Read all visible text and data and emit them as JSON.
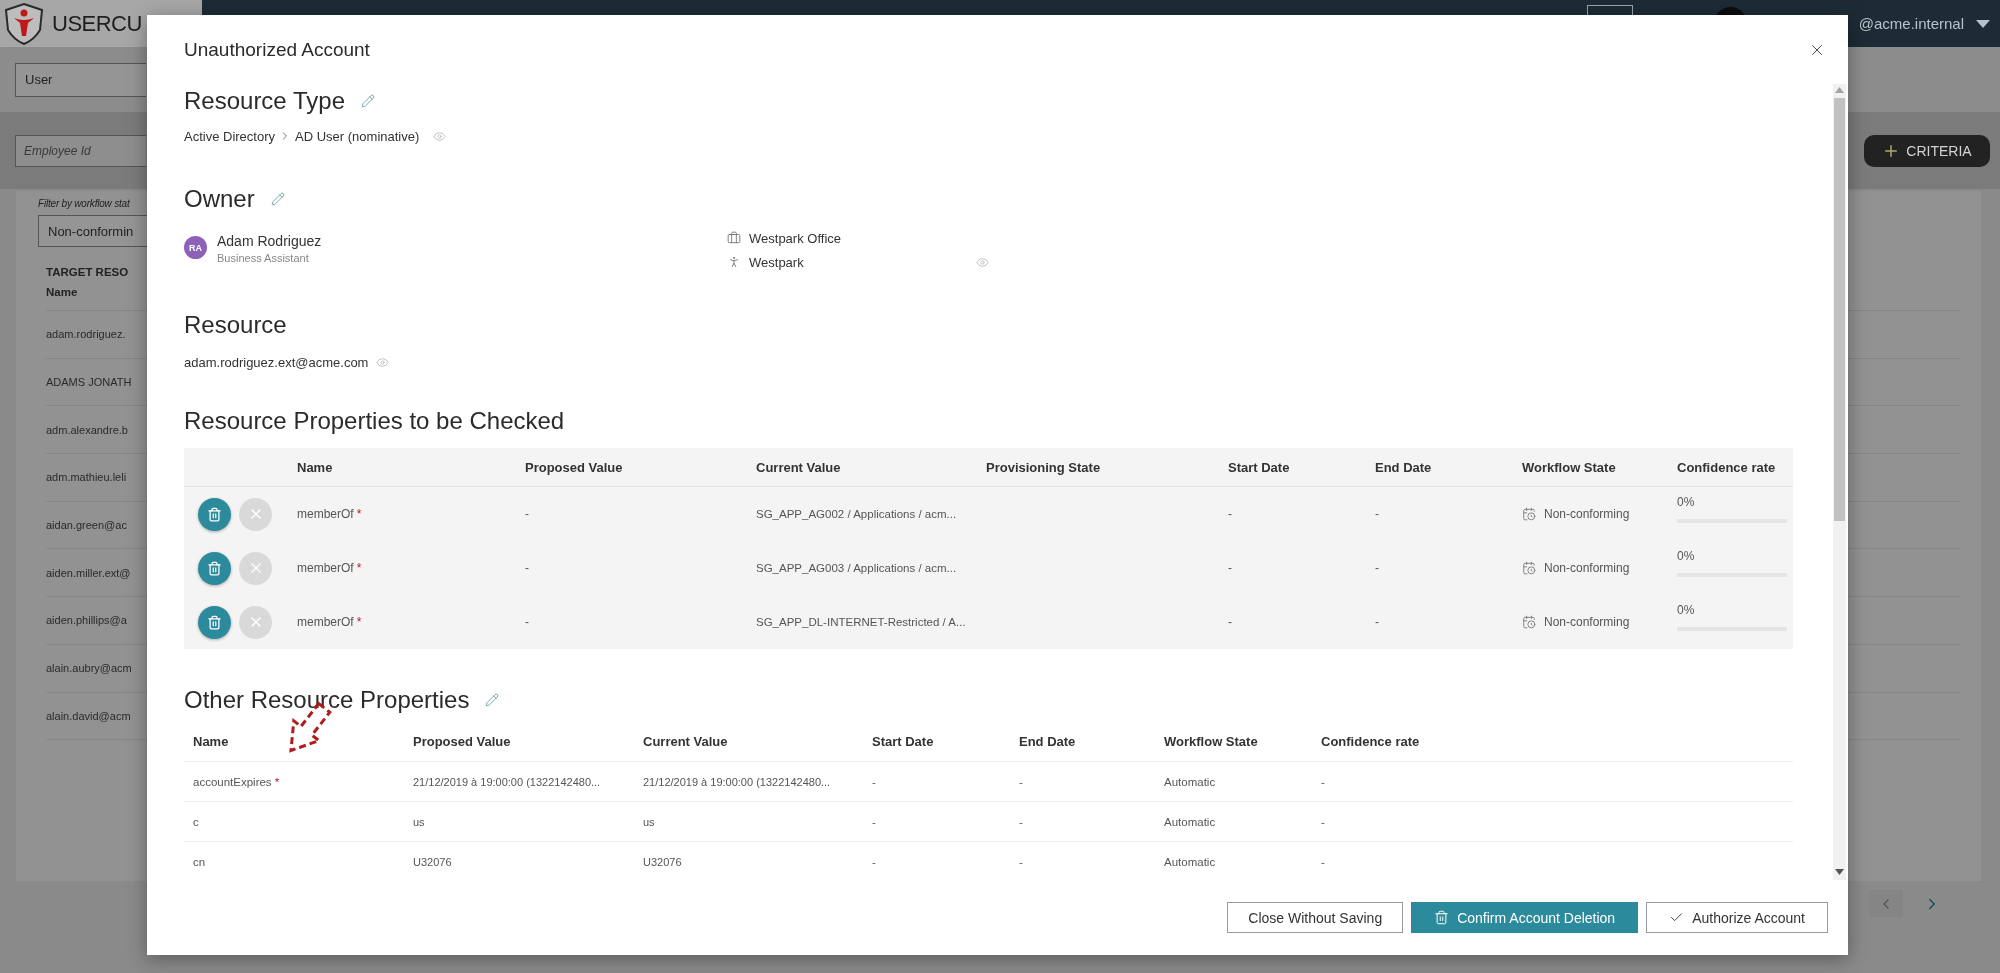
{
  "app": {
    "logo": "USERCU",
    "user": "@acme.internal",
    "entity_select": "User",
    "search": {
      "placeholder": "Employee Id"
    },
    "criteria_button": "CRITERIA",
    "filter_label": "Filter by workflow stat",
    "filter_select": "Non-conformin",
    "list": {
      "header": [
        "TARGET RESO",
        "Name"
      ],
      "rows": [
        "adam.rodriguez.",
        "ADAMS JONATH",
        "adm.alexandre.b",
        "adm.mathieu.leli",
        "aidan.green@ac",
        "aiden.miller.ext@",
        "aiden.phillips@a",
        "alain.aubry@acm",
        "alain.david@acm"
      ]
    }
  },
  "dialog": {
    "title": "Unauthorized Account",
    "resource_type": {
      "heading": "Resource Type",
      "editable": true,
      "path": [
        "Active Directory",
        "AD User (nominative)"
      ]
    },
    "owner": {
      "heading": "Owner",
      "editable": true,
      "initials": "RA",
      "name": "Adam Rodriguez",
      "role": "Business Assistant",
      "locations": [
        {
          "kind": "office",
          "label": "Westpark Office"
        },
        {
          "kind": "site",
          "label": "Westpark"
        }
      ]
    },
    "resource": {
      "heading": "Resource",
      "editable": false,
      "value": "adam.rodriguez.ext@acme.com"
    },
    "checked_properties": {
      "heading": "Resource Properties to be Checked",
      "editable": false,
      "columns": [
        "Name",
        "Proposed Value",
        "Current Value",
        "Provisioning State",
        "Start Date",
        "End Date",
        "Workflow State",
        "Confidence rate"
      ],
      "rows": [
        {
          "name": "memberOf",
          "mark": "*",
          "proposed": "-",
          "current": "SG_APP_AG002 / Applications / acm...",
          "start": "-",
          "end": "-",
          "workflow": "Non-conforming",
          "confidence": "0%",
          "level": 0
        },
        {
          "name": "memberOf",
          "mark": "*",
          "proposed": "-",
          "current": "SG_APP_AG003 / Applications / acm...",
          "start": "-",
          "end": "-",
          "workflow": "Non-conforming",
          "confidence": "0%",
          "level": 0
        },
        {
          "name": "memberOf",
          "mark": "*",
          "proposed": "-",
          "current": "SG_APP_DL-INTERNET-Restricted / A...",
          "start": "-",
          "end": "-",
          "workflow": "Non-conforming",
          "confidence": "0%",
          "level": 0
        }
      ]
    },
    "other_properties": {
      "heading": "Other Resource Properties",
      "editable": true,
      "columns": [
        "Name",
        "Proposed Value",
        "Current Value",
        "Start Date",
        "End Date",
        "Workflow State",
        "Confidence rate"
      ],
      "rows": [
        {
          "name": "accountExpires",
          "mark": "*",
          "proposed": "21/12/2019 à 19:00:00 (1322142480...",
          "current": "21/12/2019 à 19:00:00 (1322142480...",
          "start": "-",
          "end": "-",
          "workflow": "Automatic",
          "confidence": "-"
        },
        {
          "name": "c",
          "proposed": "us",
          "current": "us",
          "start": "-",
          "end": "-",
          "workflow": "Automatic",
          "confidence": "-"
        },
        {
          "name": "cn",
          "proposed": "U32076",
          "current": "U32076",
          "start": "-",
          "end": "-",
          "workflow": "Automatic",
          "confidence": "-"
        }
      ]
    },
    "buttons": [
      {
        "label": "Close Without Saving",
        "kind": "secondary"
      },
      {
        "label": "Confirm Account Deletion",
        "kind": "delete"
      },
      {
        "label": "Authorize Account",
        "kind": "authorize"
      }
    ]
  }
}
